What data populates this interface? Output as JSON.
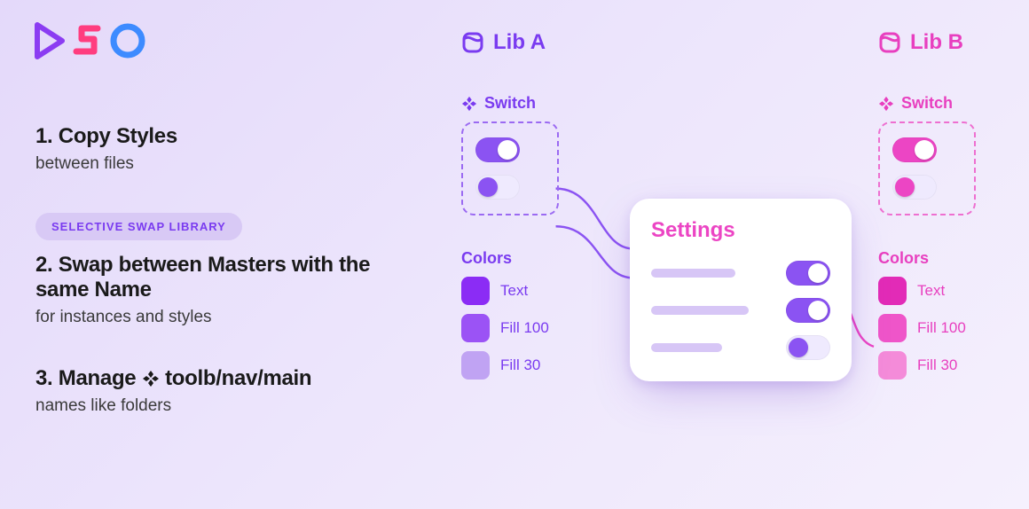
{
  "features": [
    {
      "num": "1.",
      "title_rest": "Copy Styles",
      "sub": "between files"
    },
    {
      "badge": "SELECTIVE SWAP LIBRARY",
      "num": "2.",
      "title_rest": "Swap between Masters with the same Name",
      "sub": "for instances and styles"
    },
    {
      "num": "3.",
      "title_pre": "Manage ",
      "title_post": " toolb/nav/main",
      "sub": "names like folders"
    }
  ],
  "lib_a": {
    "title": "Lib A",
    "switch_label": "Switch",
    "colors_label": "Colors",
    "colors": [
      {
        "name": "Text",
        "hex": "#8b2cf5"
      },
      {
        "name": "Fill 100",
        "hex": "#9b53f5"
      },
      {
        "name": "Fill 30",
        "hex": "#c0a3f3"
      }
    ]
  },
  "lib_b": {
    "title": "Lib B",
    "switch_label": "Switch",
    "colors_label": "Colors",
    "colors": [
      {
        "name": "Text",
        "hex": "#e22bb7"
      },
      {
        "name": "Fill 100",
        "hex": "#ef55c9"
      },
      {
        "name": "Fill 30",
        "hex": "#f48bd9"
      }
    ]
  },
  "settings": {
    "title": "Settings"
  }
}
